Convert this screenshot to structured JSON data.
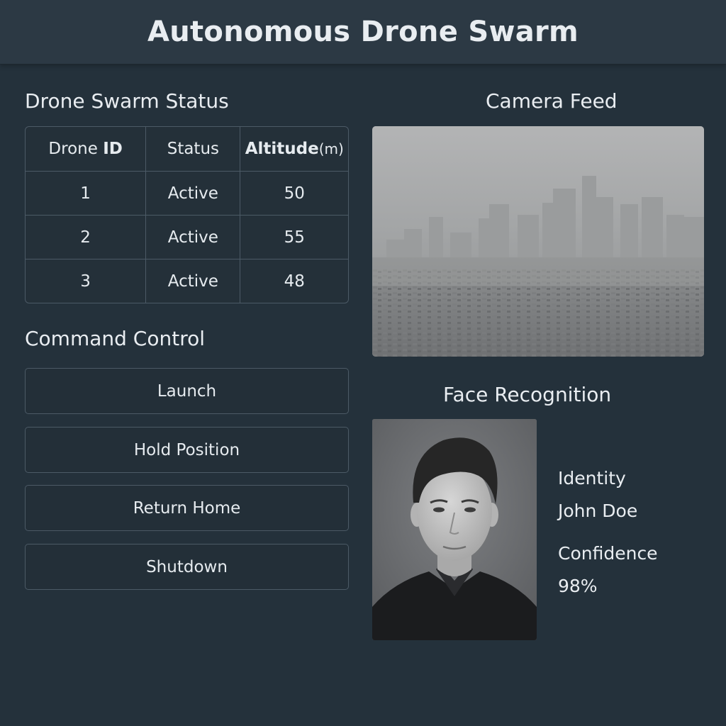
{
  "app": {
    "title": "Autonomous Drone Swarm"
  },
  "status_panel": {
    "title": "Drone Swarm Status",
    "columns": {
      "id_prefix": "Drone ",
      "id_bold": "ID",
      "status": "Status",
      "altitude": "Altitude",
      "altitude_unit": "(m)"
    },
    "rows": [
      {
        "id": "1",
        "status": "Active",
        "altitude": "50"
      },
      {
        "id": "2",
        "status": "Active",
        "altitude": "55"
      },
      {
        "id": "3",
        "status": "Active",
        "altitude": "48"
      }
    ]
  },
  "command_panel": {
    "title": "Command Control",
    "buttons": [
      {
        "label": "Launch"
      },
      {
        "label": "Hold Position"
      },
      {
        "label": "Return Home"
      },
      {
        "label": "Shutdown"
      }
    ]
  },
  "camera": {
    "title": "Camera Feed"
  },
  "face_recognition": {
    "title": "Face Recognition",
    "identity_label": "Identity",
    "identity_value": "John Doe",
    "confidence_label": "Confidence",
    "confidence_value": "98%"
  },
  "colors": {
    "background": "#24313b",
    "header": "#2c3944",
    "border": "#4c5a66",
    "text": "#e6ebef"
  }
}
